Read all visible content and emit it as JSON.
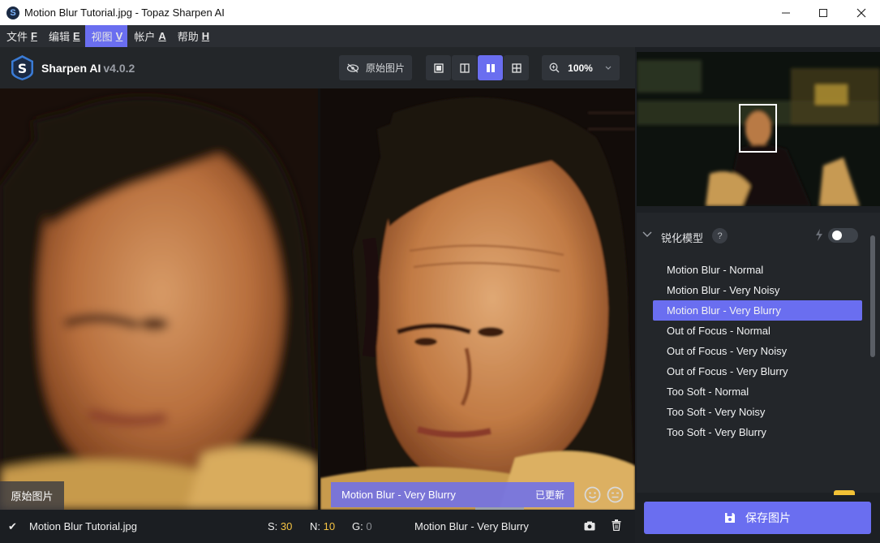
{
  "window": {
    "title": "Motion Blur Tutorial.jpg - Topaz Sharpen AI",
    "app_icon": "S",
    "controls": [
      "minimize-icon",
      "maximize-icon",
      "close-icon"
    ]
  },
  "menu": [
    {
      "label": "文件",
      "key": "F"
    },
    {
      "label": "编辑",
      "key": "E"
    },
    {
      "label": "视图",
      "key": "V",
      "active": true
    },
    {
      "label": "帐户",
      "key": "A"
    },
    {
      "label": "帮助",
      "key": "H"
    }
  ],
  "toolbar": {
    "brand": "Sharpen AI",
    "version": "v4.0.2",
    "original_btn": "原始图片",
    "view_modes": [
      "single-view-icon",
      "split-view-icon",
      "side-by-side-view-icon",
      "quad-view-icon"
    ],
    "selected_view": "side-by-side-view-icon",
    "zoom": "100%"
  },
  "preview": {
    "original_label": "原始图片",
    "model_name": "Motion Blur - Very Blurry",
    "updated": "已更新"
  },
  "status": {
    "check": "✔",
    "filename": "Motion Blur Tutorial.jpg",
    "s_label": "S:",
    "s_value": "30",
    "n_label": "N:",
    "n_value": "10",
    "g_label": "G:",
    "g_value": "0",
    "model": "Motion Blur - Very Blurry"
  },
  "panel": {
    "section_title": "锐化模型",
    "help": "?",
    "models": [
      "Motion Blur - Normal",
      "Motion Blur - Very Noisy",
      "Motion Blur - Very Blurry",
      "Out of Focus - Normal",
      "Out of Focus - Very Noisy",
      "Out of Focus - Very Blurry",
      "Too Soft - Normal",
      "Too Soft - Very Noisy",
      "Too Soft - Very Blurry"
    ],
    "selected_index": 2,
    "save_label": "保存图片"
  },
  "colors": {
    "accent": "#6a6ef0",
    "status_number": "#f5c343"
  }
}
